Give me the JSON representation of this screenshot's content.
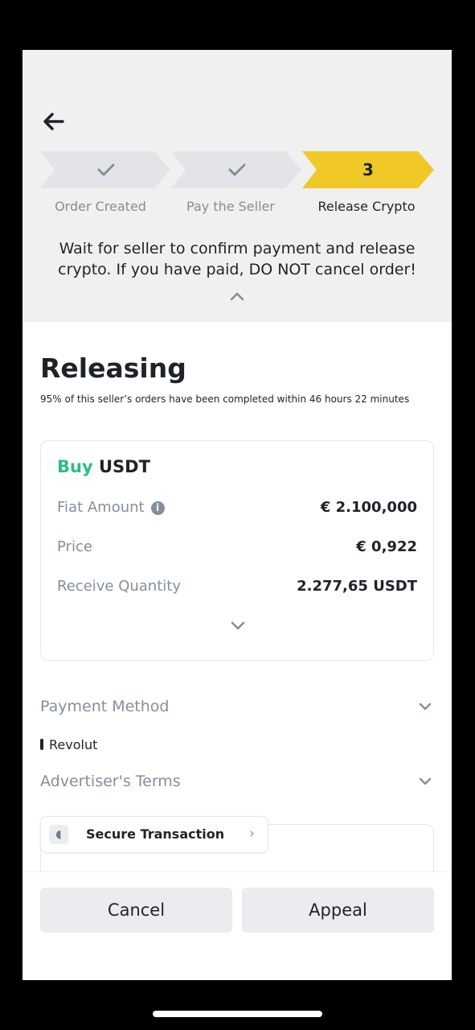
{
  "steps": [
    {
      "label": "Order Created",
      "status": "done",
      "icon": "check-icon"
    },
    {
      "label": "Pay the Seller",
      "status": "done",
      "icon": "check-icon"
    },
    {
      "label": "Release Crypto",
      "status": "active",
      "number": "3"
    }
  ],
  "notice": "Wait for seller to confirm payment and release crypto. If you have paid, DO NOT cancel order!",
  "status": {
    "title": "Releasing",
    "subtitle": "95% of this seller’s orders have been completed within 46 hours 22 minutes"
  },
  "order": {
    "side": "Buy",
    "asset": "USDT",
    "rows": [
      {
        "label": "Fiat Amount",
        "value": "€ 2.100,000"
      },
      {
        "label": "Price",
        "value": "€ 0,922"
      },
      {
        "label": "Receive Quantity",
        "value": "2.277,65 USDT"
      }
    ]
  },
  "payment_method": {
    "label": "Payment Method",
    "value": "Revolut"
  },
  "advertiser_terms": {
    "label": "Advertiser's Terms"
  },
  "secure": {
    "label": "Secure Transaction"
  },
  "actions": {
    "cancel": "Cancel",
    "appeal": "Appeal"
  },
  "colors": {
    "accent_yellow": "#f0c929",
    "buy_green": "#2ebd85",
    "step_grey": "#e2e4e8"
  }
}
